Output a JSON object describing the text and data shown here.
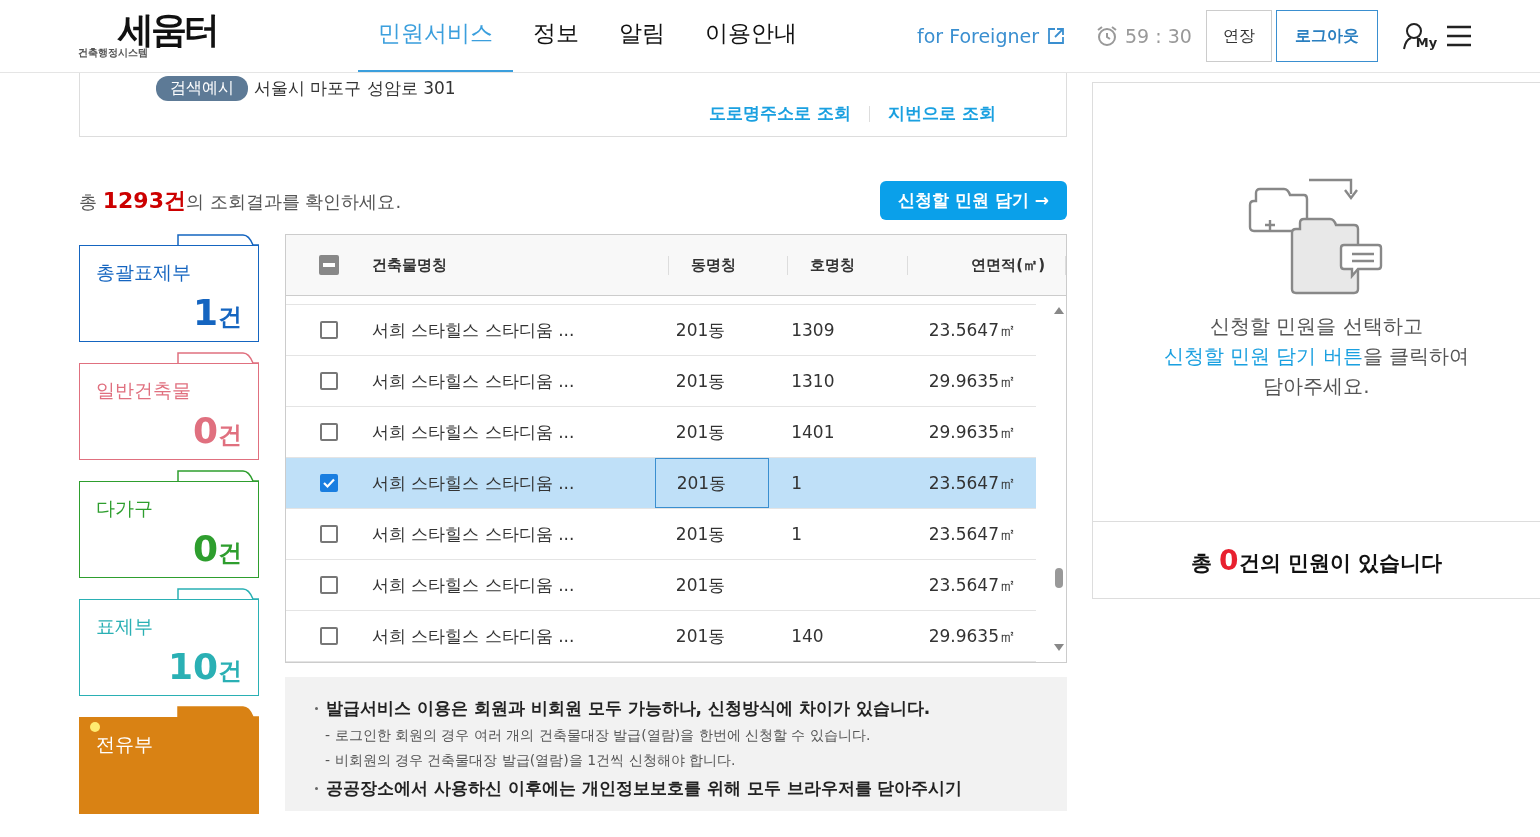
{
  "header": {
    "logo": {
      "mark": "세움터",
      "subtitle": "건축행정시스템"
    },
    "nav": [
      {
        "label": "민원서비스",
        "selected": true
      },
      {
        "label": "정보",
        "selected": false
      },
      {
        "label": "알림",
        "selected": false
      },
      {
        "label": "이용안내",
        "selected": false
      }
    ],
    "foreigner_link": "for Foreigner",
    "timer": "59 : 30",
    "extend_button": "연장",
    "logout_button": "로그아웃",
    "my_label": "My"
  },
  "search": {
    "example_tag": "검색예시",
    "example_text": "서울시 마포구 성암로 301",
    "links": [
      "도로명주소로 조회",
      "지번으로 조회"
    ]
  },
  "result": {
    "prefix": "총 ",
    "count": "1293건",
    "suffix": "의 조회결과를 확인하세요.",
    "add_button": "신청할 민원 담기 →"
  },
  "categories": [
    {
      "label": "총괄표제부",
      "count": "1",
      "unit": "건",
      "color": "#1565c0",
      "selected": false
    },
    {
      "label": "일반건축물",
      "count": "0",
      "unit": "건",
      "color": "#e0707f",
      "selected": false
    },
    {
      "label": "다가구",
      "count": "0",
      "unit": "건",
      "color": "#2e9e2e",
      "selected": false
    },
    {
      "label": "표제부",
      "count": "10",
      "unit": "건",
      "color": "#2ab0b4",
      "selected": false
    },
    {
      "label": "전유부",
      "color": "#d98214",
      "selected": true
    }
  ],
  "table": {
    "select_all_indeterminate": true,
    "columns": [
      "건축물명칭",
      "동명칭",
      "호명칭",
      "연면적(㎡)"
    ],
    "rows": [
      {
        "checked": false,
        "focused": false,
        "cells": [
          "서희 스타힐스 스타디움 ...",
          "201동",
          "1309",
          "23.5647㎡"
        ]
      },
      {
        "checked": false,
        "focused": false,
        "cells": [
          "서희 스타힐스 스타디움 ...",
          "201동",
          "1310",
          "29.9635㎡"
        ]
      },
      {
        "checked": false,
        "focused": false,
        "cells": [
          "서희 스타힐스 스타디움 ...",
          "201동",
          "1401",
          "29.9635㎡"
        ]
      },
      {
        "checked": true,
        "focused": true,
        "cells": [
          "서희 스타힐스 스타디움 ...",
          "201동",
          "1",
          "23.5647㎡"
        ]
      },
      {
        "checked": false,
        "focused": false,
        "cells": [
          "서희 스타힐스 스타디움 ...",
          "201동",
          "1",
          "23.5647㎡"
        ]
      },
      {
        "checked": false,
        "focused": false,
        "cells": [
          "서희 스타힐스 스타디움 ...",
          "201동",
          "",
          "23.5647㎡"
        ]
      },
      {
        "checked": false,
        "focused": false,
        "cells": [
          "서희 스타힐스 스타디움 ...",
          "201동",
          "140",
          "29.9635㎡"
        ]
      }
    ]
  },
  "notice": [
    {
      "kind": "bullet",
      "text": "발급서비스 이용은 회원과 비회원 모두 가능하나, 신청방식에 차이가 있습니다."
    },
    {
      "kind": "dash",
      "text": "- 로그인한 회원의 경우 여러 개의 건축물대장 발급(열람)을 한번에 신청할 수 있습니다."
    },
    {
      "kind": "dash",
      "text": "- 비회원의 경우 건축물대장 발급(열람)을 1건씩 신청해야 합니다."
    },
    {
      "kind": "bullet",
      "text": "공공장소에서 사용하신 이후에는 개인정보보호를 위해 모두 브라우저를 닫아주시기"
    }
  ],
  "cart": {
    "guide": [
      "신청할 민원을 선택하고",
      "**신청할 민원 담기 버튼**을 클릭하여",
      "담아주세요."
    ],
    "total_prefix": "총 ",
    "total_count": "0",
    "total_suffix": "건의 민원이 있습니다"
  }
}
